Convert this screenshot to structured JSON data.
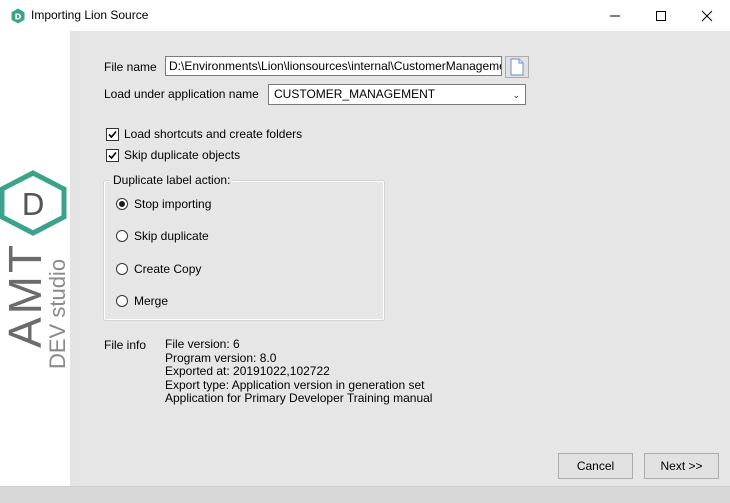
{
  "window": {
    "title": "Importing Lion Source",
    "accent": "#3aa38a"
  },
  "logo": {
    "letter": "D",
    "brand": "AMT",
    "subtitle": "DEV studio"
  },
  "form": {
    "file_name_label": "File name",
    "file_name_value": "D:\\Environments\\Lion\\lionsources\\internal\\CustomerManagement",
    "app_name_label": "Load under application name",
    "app_name_value": "CUSTOMER_MANAGEMENT",
    "load_shortcuts_label": "Load shortcuts and create folders",
    "load_shortcuts_checked": true,
    "skip_duplicates_label": "Skip duplicate objects",
    "skip_duplicates_checked": true
  },
  "duplicate_action": {
    "legend": "Duplicate label action:",
    "options": [
      {
        "label": "Stop importing",
        "selected": true
      },
      {
        "label": "Skip duplicate",
        "selected": false
      },
      {
        "label": "Create Copy",
        "selected": false
      },
      {
        "label": "Merge",
        "selected": false
      }
    ]
  },
  "file_info": {
    "label": "File info",
    "lines": [
      "File version: 6",
      "Program version: 8.0",
      "Exported at: 20191022,102722",
      "Export type: Application version in generation set",
      "Application for Primary Developer Training manual"
    ]
  },
  "buttons": {
    "cancel": "Cancel",
    "next": "Next >>"
  }
}
